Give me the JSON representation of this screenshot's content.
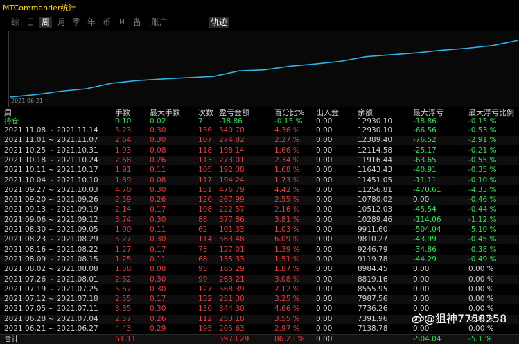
{
  "app": {
    "title": "MTCommander统计"
  },
  "tabs": [
    {
      "label": "综"
    },
    {
      "label": "日"
    },
    {
      "label": "周"
    },
    {
      "label": "月"
    },
    {
      "label": "季"
    },
    {
      "label": "年"
    },
    {
      "label": "币"
    },
    {
      "label": "M"
    },
    {
      "label": "备"
    },
    {
      "label": "账户"
    },
    {
      "label": "轨迹"
    }
  ],
  "active_tab": "周",
  "chart": {
    "start_label": "2021.06.21",
    "line_color": "#2fb4e6",
    "balances": [
      7138.78,
      7391.96,
      7736.26,
      7987.56,
      8555.95,
      8819.16,
      8984.45,
      9119.78,
      9246.79,
      9810.27,
      9911.6,
      10289.46,
      10512.03,
      10780.02,
      11256.81,
      11451.05,
      11643.43,
      11916.44,
      12114.58,
      12389.4,
      12930.1
    ]
  },
  "table": {
    "headers": {
      "period": "周",
      "lots": "手数",
      "max_lots": "最大手数",
      "count": "次数",
      "pl": "盈亏金额",
      "pct": "百分比%",
      "io": "出入金",
      "balance": "余额",
      "max_dd": "最大浮亏",
      "max_dd_pct": "最大浮亏比例"
    },
    "open_position": {
      "period": "持仓",
      "lots": "0.10",
      "max_lots": "0.02",
      "count": "7",
      "pl": "-18.86",
      "pct": "-0.15 %",
      "io": "0.00",
      "balance": "12930.10",
      "max_dd": "-18.86",
      "max_dd_pct": "-0.15 %"
    },
    "rows": [
      {
        "period": "2021.11.08 ~ 2021.11.14",
        "lots": "5.23",
        "max_lots": "0.30",
        "count": "136",
        "pl": "540.70",
        "pct": "4.36 %",
        "io": "0.00",
        "balance": "12930.10",
        "max_dd": "-66.56",
        "max_dd_pct": "-0.53 %"
      },
      {
        "period": "2021.11.01 ~ 2021.11.07",
        "lots": "2.64",
        "max_lots": "0.30",
        "count": "107",
        "pl": "274.82",
        "pct": "2.27 %",
        "io": "0.00",
        "balance": "12389.40",
        "max_dd": "-76.52",
        "max_dd_pct": "-2.91 %"
      },
      {
        "period": "2021.10.25 ~ 2021.10.31",
        "lots": "1.93",
        "max_lots": "0.08",
        "count": "118",
        "pl": "198.14",
        "pct": "1.66 %",
        "io": "0.00",
        "balance": "12114.58",
        "max_dd": "-25.17",
        "max_dd_pct": "-0.21 %"
      },
      {
        "period": "2021.10.18 ~ 2021.10.24",
        "lots": "2.68",
        "max_lots": "0.26",
        "count": "113",
        "pl": "273.01",
        "pct": "2.34 %",
        "io": "0.00",
        "balance": "11916.44",
        "max_dd": "-63.65",
        "max_dd_pct": "-0.55 %"
      },
      {
        "period": "2021.10.11 ~ 2021.10.17",
        "lots": "1.91",
        "max_lots": "0.11",
        "count": "105",
        "pl": "192.38",
        "pct": "1.68 %",
        "io": "0.00",
        "balance": "11643.43",
        "max_dd": "-40.91",
        "max_dd_pct": "-0.35 %"
      },
      {
        "period": "2021.10.04 ~ 2021.10.10",
        "lots": "1.89",
        "max_lots": "0.08",
        "count": "117",
        "pl": "194.24",
        "pct": "1.73 %",
        "io": "0.00",
        "balance": "11451.05",
        "max_dd": "-11.11",
        "max_dd_pct": "-0.10 %"
      },
      {
        "period": "2021.09.27 ~ 2021.10.03",
        "lots": "4.70",
        "max_lots": "0.30",
        "count": "151",
        "pl": "476.79",
        "pct": "4.42 %",
        "io": "0.00",
        "balance": "11256.81",
        "max_dd": "-470.61",
        "max_dd_pct": "-4.33 %"
      },
      {
        "period": "2021.09.20 ~ 2021.09.26",
        "lots": "2.59",
        "max_lots": "0.26",
        "count": "120",
        "pl": "267.99",
        "pct": "2.55 %",
        "io": "0.00",
        "balance": "10780.02",
        "max_dd": "0.00",
        "max_dd_pct": "-0.46 %"
      },
      {
        "period": "2021.09.13 ~ 2021.09.19",
        "lots": "2.14",
        "max_lots": "0.17",
        "count": "108",
        "pl": "222.57",
        "pct": "2.16 %",
        "io": "0.00",
        "balance": "10512.03",
        "max_dd": "-45.54",
        "max_dd_pct": "-0.44 %"
      },
      {
        "period": "2021.09.06 ~ 2021.09.12",
        "lots": "3.74",
        "max_lots": "0.30",
        "count": "88",
        "pl": "377.86",
        "pct": "3.81 %",
        "io": "0.00",
        "balance": "10289.46",
        "max_dd": "-114.06",
        "max_dd_pct": "-1.12 %"
      },
      {
        "period": "2021.08.30 ~ 2021.09.05",
        "lots": "1.00",
        "max_lots": "0.11",
        "count": "62",
        "pl": "101.33",
        "pct": "1.03 %",
        "io": "0.00",
        "balance": "9911.60",
        "max_dd": "-504.04",
        "max_dd_pct": "-5.10 %"
      },
      {
        "period": "2021.08.23 ~ 2021.08.29",
        "lots": "5.27",
        "max_lots": "0.30",
        "count": "114",
        "pl": "563.48",
        "pct": "6.09 %",
        "io": "0.00",
        "balance": "9810.27",
        "max_dd": "-43.99",
        "max_dd_pct": "-0.45 %"
      },
      {
        "period": "2021.08.16 ~ 2021.08.22",
        "lots": "1.27",
        "max_lots": "0.17",
        "count": "73",
        "pl": "127.01",
        "pct": "1.39 %",
        "io": "0.00",
        "balance": "9246.79",
        "max_dd": "-34.86",
        "max_dd_pct": "-0.38 %"
      },
      {
        "period": "2021.08.09 ~ 2021.08.15",
        "lots": "1.25",
        "max_lots": "0.11",
        "count": "68",
        "pl": "135.33",
        "pct": "1.51 %",
        "io": "0.00",
        "balance": "9119.78",
        "max_dd": "-44.29",
        "max_dd_pct": "-0.49 %"
      },
      {
        "period": "2021.08.02 ~ 2021.08.08",
        "lots": "1.58",
        "max_lots": "0.08",
        "count": "95",
        "pl": "165.29",
        "pct": "1.87 %",
        "io": "0.00",
        "balance": "8984.45",
        "max_dd": "0.00",
        "max_dd_pct": "0.00 %"
      },
      {
        "period": "2021.07.26 ~ 2021.08.01",
        "lots": "2.62",
        "max_lots": "0.30",
        "count": "99",
        "pl": "263.21",
        "pct": "3.08 %",
        "io": "0.00",
        "balance": "8819.16",
        "max_dd": "0.00",
        "max_dd_pct": "0.00 %"
      },
      {
        "period": "2021.07.19 ~ 2021.07.25",
        "lots": "5.67",
        "max_lots": "0.30",
        "count": "127",
        "pl": "568.39",
        "pct": "7.12 %",
        "io": "0.00",
        "balance": "8555.95",
        "max_dd": "0.00",
        "max_dd_pct": "0.00 %"
      },
      {
        "period": "2021.07.12 ~ 2021.07.18",
        "lots": "2.55",
        "max_lots": "0.17",
        "count": "132",
        "pl": "251.30",
        "pct": "3.25 %",
        "io": "0.00",
        "balance": "7987.56",
        "max_dd": "0.00",
        "max_dd_pct": "0.00 %"
      },
      {
        "period": "2021.07.05 ~ 2021.07.11",
        "lots": "3.35",
        "max_lots": "0.30",
        "count": "130",
        "pl": "344.30",
        "pct": "4.66 %",
        "io": "0.00",
        "balance": "7736.26",
        "max_dd": "0.00",
        "max_dd_pct": "0.00 %"
      },
      {
        "period": "2021.06.28 ~ 2021.07.04",
        "lots": "2.57",
        "max_lots": "0.26",
        "count": "112",
        "pl": "253.18",
        "pct": "3.55 %",
        "io": "0.00",
        "balance": "7391.96",
        "max_dd": "0.00",
        "max_dd_pct": "0.00 %"
      },
      {
        "period": "2021.06.21 ~ 2021.06.27",
        "lots": "4.43",
        "max_lots": "0.29",
        "count": "195",
        "pl": "205.63",
        "pct": "2.97 %",
        "io": "0.00",
        "balance": "7138.78",
        "max_dd": "0.00",
        "max_dd_pct": "0.00 %"
      }
    ],
    "total": {
      "period": "合计",
      "lots": "61.11",
      "max_lots": "",
      "count": "",
      "pl": "5978.29",
      "pct": "86.23 %",
      "io": "0.00",
      "balance": "",
      "max_dd": "-504.04",
      "max_dd_pct": "-5.1 %"
    }
  },
  "watermark": {
    "text": "@狙神7758258"
  },
  "colors": {
    "gain": "#e23b3b",
    "loss": "#33dd55",
    "title": "#ffd700"
  }
}
